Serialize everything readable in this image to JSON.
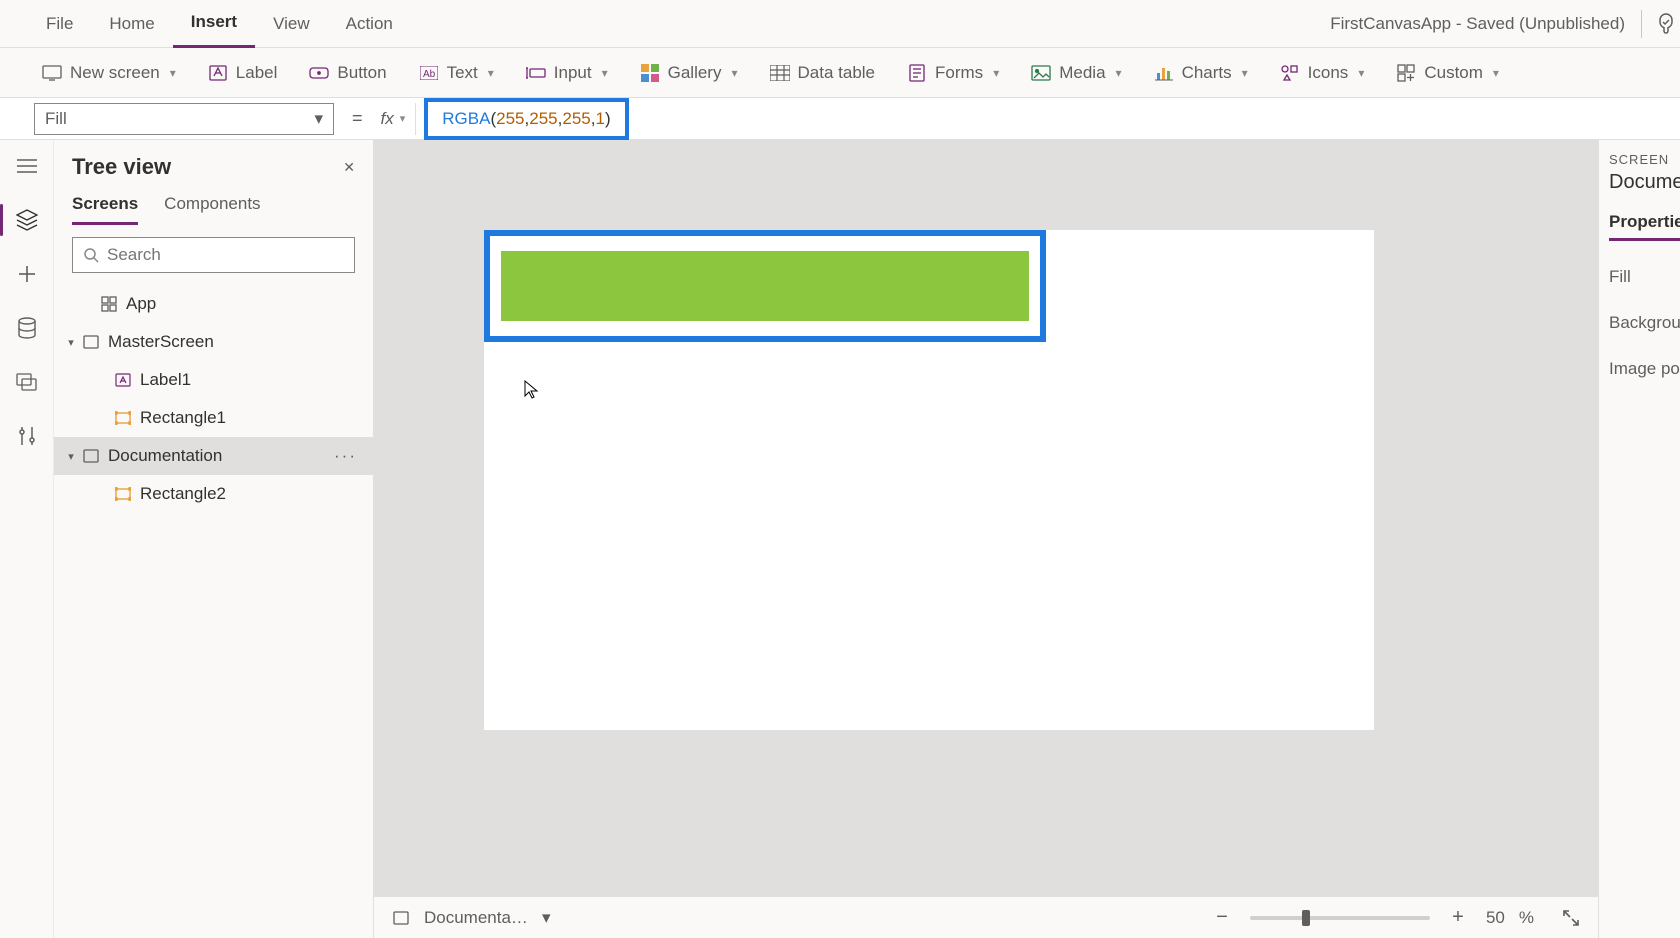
{
  "app_title": "FirstCanvasApp - Saved (Unpublished)",
  "menu": {
    "file": "File",
    "home": "Home",
    "insert": "Insert",
    "view": "View",
    "action": "Action"
  },
  "active_menu": "insert",
  "ribbon": {
    "new_screen": "New screen",
    "label": "Label",
    "button": "Button",
    "text": "Text",
    "input": "Input",
    "gallery": "Gallery",
    "data_table": "Data table",
    "forms": "Forms",
    "media": "Media",
    "charts": "Charts",
    "icons": "Icons",
    "custom": "Custom"
  },
  "formula": {
    "property": "Fill",
    "fn": "RGBA",
    "open": "(",
    "n1": "255",
    "c": ",",
    "sp": " ",
    "n2": "255",
    "n3": "255",
    "n4": "1",
    "close": ")"
  },
  "tree": {
    "title": "Tree view",
    "tab_screens": "Screens",
    "tab_components": "Components",
    "search_placeholder": "Search",
    "items": {
      "app": "App",
      "master": "MasterScreen",
      "label1": "Label1",
      "rect1": "Rectangle1",
      "doc": "Documentation",
      "rect2": "Rectangle2"
    }
  },
  "props": {
    "section": "SCREEN",
    "screen_name": "Document",
    "tab": "Properties",
    "fill": "Fill",
    "bg": "Background",
    "imgpos": "Image posit"
  },
  "status": {
    "breadcrumb": "Documenta…",
    "zoom_pct": "50",
    "zoom_unit": "%"
  }
}
